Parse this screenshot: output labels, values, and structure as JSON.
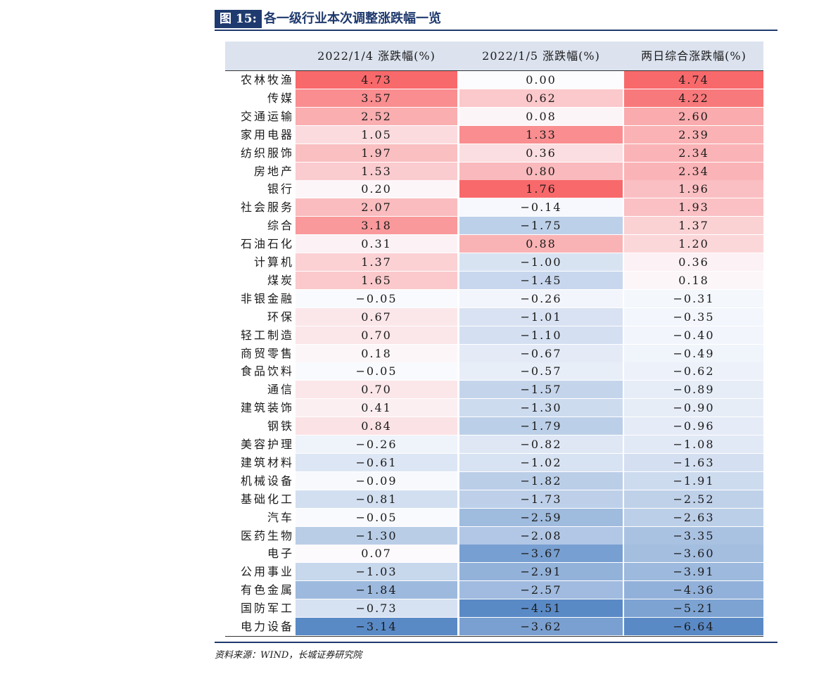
{
  "title": {
    "label": "图 15:",
    "text": "各一级行业本次调整涨跌幅一览"
  },
  "table": {
    "headers": [
      "2022/1/4 涨跌幅(%)",
      "2022/1/5 涨跌幅(%)",
      "两日综合涨跌幅(%)"
    ],
    "rows": [
      {
        "name": "农林牧渔",
        "v": [
          "4.73",
          "0.00",
          "4.74"
        ]
      },
      {
        "name": "传媒",
        "v": [
          "3.57",
          "0.62",
          "4.22"
        ]
      },
      {
        "name": "交通运输",
        "v": [
          "2.52",
          "0.08",
          "2.60"
        ]
      },
      {
        "name": "家用电器",
        "v": [
          "1.05",
          "1.33",
          "2.39"
        ]
      },
      {
        "name": "纺织服饰",
        "v": [
          "1.97",
          "0.36",
          "2.34"
        ]
      },
      {
        "name": "房地产",
        "v": [
          "1.53",
          "0.80",
          "2.34"
        ]
      },
      {
        "name": "银行",
        "v": [
          "0.20",
          "1.76",
          "1.96"
        ]
      },
      {
        "name": "社会服务",
        "v": [
          "2.07",
          "-0.14",
          "1.93"
        ]
      },
      {
        "name": "综合",
        "v": [
          "3.18",
          "-1.75",
          "1.37"
        ]
      },
      {
        "name": "石油石化",
        "v": [
          "0.31",
          "0.88",
          "1.20"
        ]
      },
      {
        "name": "计算机",
        "v": [
          "1.37",
          "-1.00",
          "0.36"
        ]
      },
      {
        "name": "煤炭",
        "v": [
          "1.65",
          "-1.45",
          "0.18"
        ]
      },
      {
        "name": "非银金融",
        "v": [
          "-0.05",
          "-0.26",
          "-0.31"
        ]
      },
      {
        "name": "环保",
        "v": [
          "0.67",
          "-1.01",
          "-0.35"
        ]
      },
      {
        "name": "轻工制造",
        "v": [
          "0.70",
          "-1.10",
          "-0.40"
        ]
      },
      {
        "name": "商贸零售",
        "v": [
          "0.18",
          "-0.67",
          "-0.49"
        ]
      },
      {
        "name": "食品饮料",
        "v": [
          "-0.05",
          "-0.57",
          "-0.62"
        ]
      },
      {
        "name": "通信",
        "v": [
          "0.70",
          "-1.57",
          "-0.89"
        ]
      },
      {
        "name": "建筑装饰",
        "v": [
          "0.41",
          "-1.30",
          "-0.90"
        ]
      },
      {
        "name": "钢铁",
        "v": [
          "0.84",
          "-1.79",
          "-0.96"
        ]
      },
      {
        "name": "美容护理",
        "v": [
          "-0.26",
          "-0.82",
          "-1.08"
        ]
      },
      {
        "name": "建筑材料",
        "v": [
          "-0.61",
          "-1.02",
          "-1.63"
        ]
      },
      {
        "name": "机械设备",
        "v": [
          "-0.09",
          "-1.82",
          "-1.91"
        ]
      },
      {
        "name": "基础化工",
        "v": [
          "-0.81",
          "-1.73",
          "-2.52"
        ]
      },
      {
        "name": "汽车",
        "v": [
          "-0.05",
          "-2.59",
          "-2.63"
        ]
      },
      {
        "name": "医药生物",
        "v": [
          "-1.30",
          "-2.08",
          "-3.35"
        ]
      },
      {
        "name": "电子",
        "v": [
          "0.07",
          "-3.67",
          "-3.60"
        ]
      },
      {
        "name": "公用事业",
        "v": [
          "-1.03",
          "-2.91",
          "-3.91"
        ]
      },
      {
        "name": "有色金属",
        "v": [
          "-1.84",
          "-2.57",
          "-4.36"
        ]
      },
      {
        "name": "国防军工",
        "v": [
          "-0.73",
          "-4.51",
          "-5.21"
        ]
      },
      {
        "name": "电力设备",
        "v": [
          "-3.14",
          "-3.62",
          "-6.64"
        ]
      }
    ]
  },
  "colors": {
    "positive": "#f8696b",
    "neutral": "#fcfcff",
    "negative": "#5a8ac6",
    "title_bg": "#1f3a6e"
  },
  "source": "资料来源：WIND，长城证券研究院"
}
